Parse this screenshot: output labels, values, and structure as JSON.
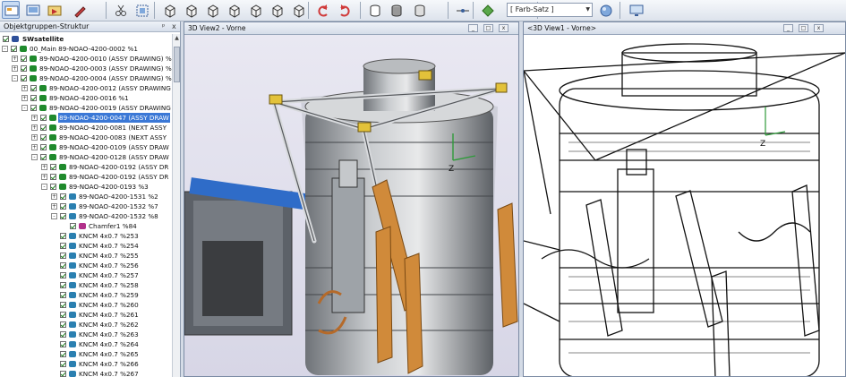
{
  "toolbar": {
    "buttons": [
      "views-icon",
      "screen-icon",
      "cursor-icon",
      "pen-icon",
      "cut-icon",
      "fit-icon",
      "cube-front-icon",
      "cube-back-icon",
      "cube-left-icon",
      "cube-right-icon",
      "cube-top-icon",
      "cube-bottom-icon",
      "cube-iso-icon",
      "rotate-left-icon",
      "rotate-right-icon",
      "cylinder-outline-icon",
      "cylinder-solid-icon",
      "cylinder-section-icon",
      "axis-icon",
      "color-icon",
      "sphere-icon",
      "monitor-icon"
    ],
    "color_set": "[ Farb-Satz ]"
  },
  "panel": {
    "title": "Objektgruppen-Struktur",
    "pin": "ᵖ",
    "close": "x",
    "root": "SWsatellite",
    "items": [
      {
        "label": "00_Main 89-NOAO-4200-0002 %1",
        "level": 1,
        "expander": "-",
        "icon": "asm"
      },
      {
        "label": "89-NOAO-4200-0010 (ASSY DRAWING) %",
        "level": 2,
        "expander": "+",
        "icon": "asm"
      },
      {
        "label": "89-NOAO-4200-0003 (ASSY DRAWING) %",
        "level": 2,
        "expander": "+",
        "icon": "asm"
      },
      {
        "label": "89-NOAO-4200-0004 (ASSY DRAWING) %",
        "level": 2,
        "expander": "-",
        "icon": "asm"
      },
      {
        "label": "89-NOAO-4200-0012 (ASSY DRAWING",
        "level": 3,
        "expander": "+",
        "icon": "asm"
      },
      {
        "label": "89-NOAO-4200-0016 %1",
        "level": 3,
        "expander": "+",
        "icon": "asm"
      },
      {
        "label": "89-NOAO-4200-0019 (ASSY DRAWING",
        "level": 3,
        "expander": "-",
        "icon": "asm"
      },
      {
        "label": "89-NOAO-4200-0047 (ASSY DRAW",
        "level": 4,
        "expander": "+",
        "icon": "asm",
        "selected": true
      },
      {
        "label": "89-NOAO-4200-0081 (NEXT ASSY",
        "level": 4,
        "expander": "+",
        "icon": "asm"
      },
      {
        "label": "89-NOAO-4200-0083 (NEXT ASSY",
        "level": 4,
        "expander": "+",
        "icon": "asm"
      },
      {
        "label": "89-NOAO-4200-0109 (ASSY DRAW",
        "level": 4,
        "expander": "+",
        "icon": "asm"
      },
      {
        "label": "89-NOAO-4200-0128 (ASSY DRAW",
        "level": 4,
        "expander": "-",
        "icon": "asm"
      },
      {
        "label": "89-NOAO-4200-0192 (ASSY DR",
        "level": 5,
        "expander": "+",
        "icon": "asm"
      },
      {
        "label": "89-NOAO-4200-0192 (ASSY DR",
        "level": 5,
        "expander": "+",
        "icon": "asm"
      },
      {
        "label": "89-NOAO-4200-0193 %3",
        "level": 5,
        "expander": "-",
        "icon": "asm"
      },
      {
        "label": "89-NOAO-4200-1531 %2",
        "level": 6,
        "expander": "+",
        "icon": "part"
      },
      {
        "label": "89-NOAO-4200-1532 %7",
        "level": 6,
        "expander": "+",
        "icon": "part"
      },
      {
        "label": "89-NOAO-4200-1532 %8",
        "level": 6,
        "expander": "-",
        "icon": "part"
      },
      {
        "label": "Chamfer1 %84",
        "level": 7,
        "expander": "",
        "icon": "feature"
      },
      {
        "label": "KNCM 4x0.7 %253",
        "level": 6,
        "expander": "",
        "icon": "part"
      },
      {
        "label": "KNCM 4x0.7 %254",
        "level": 6,
        "expander": "",
        "icon": "part"
      },
      {
        "label": "KNCM 4x0.7 %255",
        "level": 6,
        "expander": "",
        "icon": "part"
      },
      {
        "label": "KNCM 4x0.7 %256",
        "level": 6,
        "expander": "",
        "icon": "part"
      },
      {
        "label": "KNCM 4x0.7 %257",
        "level": 6,
        "expander": "",
        "icon": "part"
      },
      {
        "label": "KNCM 4x0.7 %258",
        "level": 6,
        "expander": "",
        "icon": "part"
      },
      {
        "label": "KNCM 4x0.7 %259",
        "level": 6,
        "expander": "",
        "icon": "part"
      },
      {
        "label": "KNCM 4x0.7 %260",
        "level": 6,
        "expander": "",
        "icon": "part"
      },
      {
        "label": "KNCM 4x0.7 %261",
        "level": 6,
        "expander": "",
        "icon": "part"
      },
      {
        "label": "KNCM 4x0.7 %262",
        "level": 6,
        "expander": "",
        "icon": "part"
      },
      {
        "label": "KNCM 4x0.7 %263",
        "level": 6,
        "expander": "",
        "icon": "part"
      },
      {
        "label": "KNCM 4x0.7 %264",
        "level": 6,
        "expander": "",
        "icon": "part"
      },
      {
        "label": "KNCM 4x0.7 %265",
        "level": 6,
        "expander": "",
        "icon": "part"
      },
      {
        "label": "KNCM 4x0.7 %266",
        "level": 6,
        "expander": "",
        "icon": "part"
      },
      {
        "label": "KNCM 4x0.7 %267",
        "level": 6,
        "expander": "",
        "icon": "part"
      }
    ]
  },
  "views": [
    {
      "title": "3D View2 - Vorne",
      "style": "shaded"
    },
    {
      "title": "<3D View1 - Vorne>",
      "style": "hidden-line"
    }
  ],
  "window_buttons": {
    "minimize": "_",
    "restore": "□",
    "close": "x"
  },
  "axis_label": "Z",
  "colors": {
    "selection": "#3b78d6",
    "viewport_bg": "#e4e3f0",
    "bracket_orange": "#d08a3a",
    "bracket_blue": "#2f6cc8",
    "gold": "#e3c23a"
  }
}
